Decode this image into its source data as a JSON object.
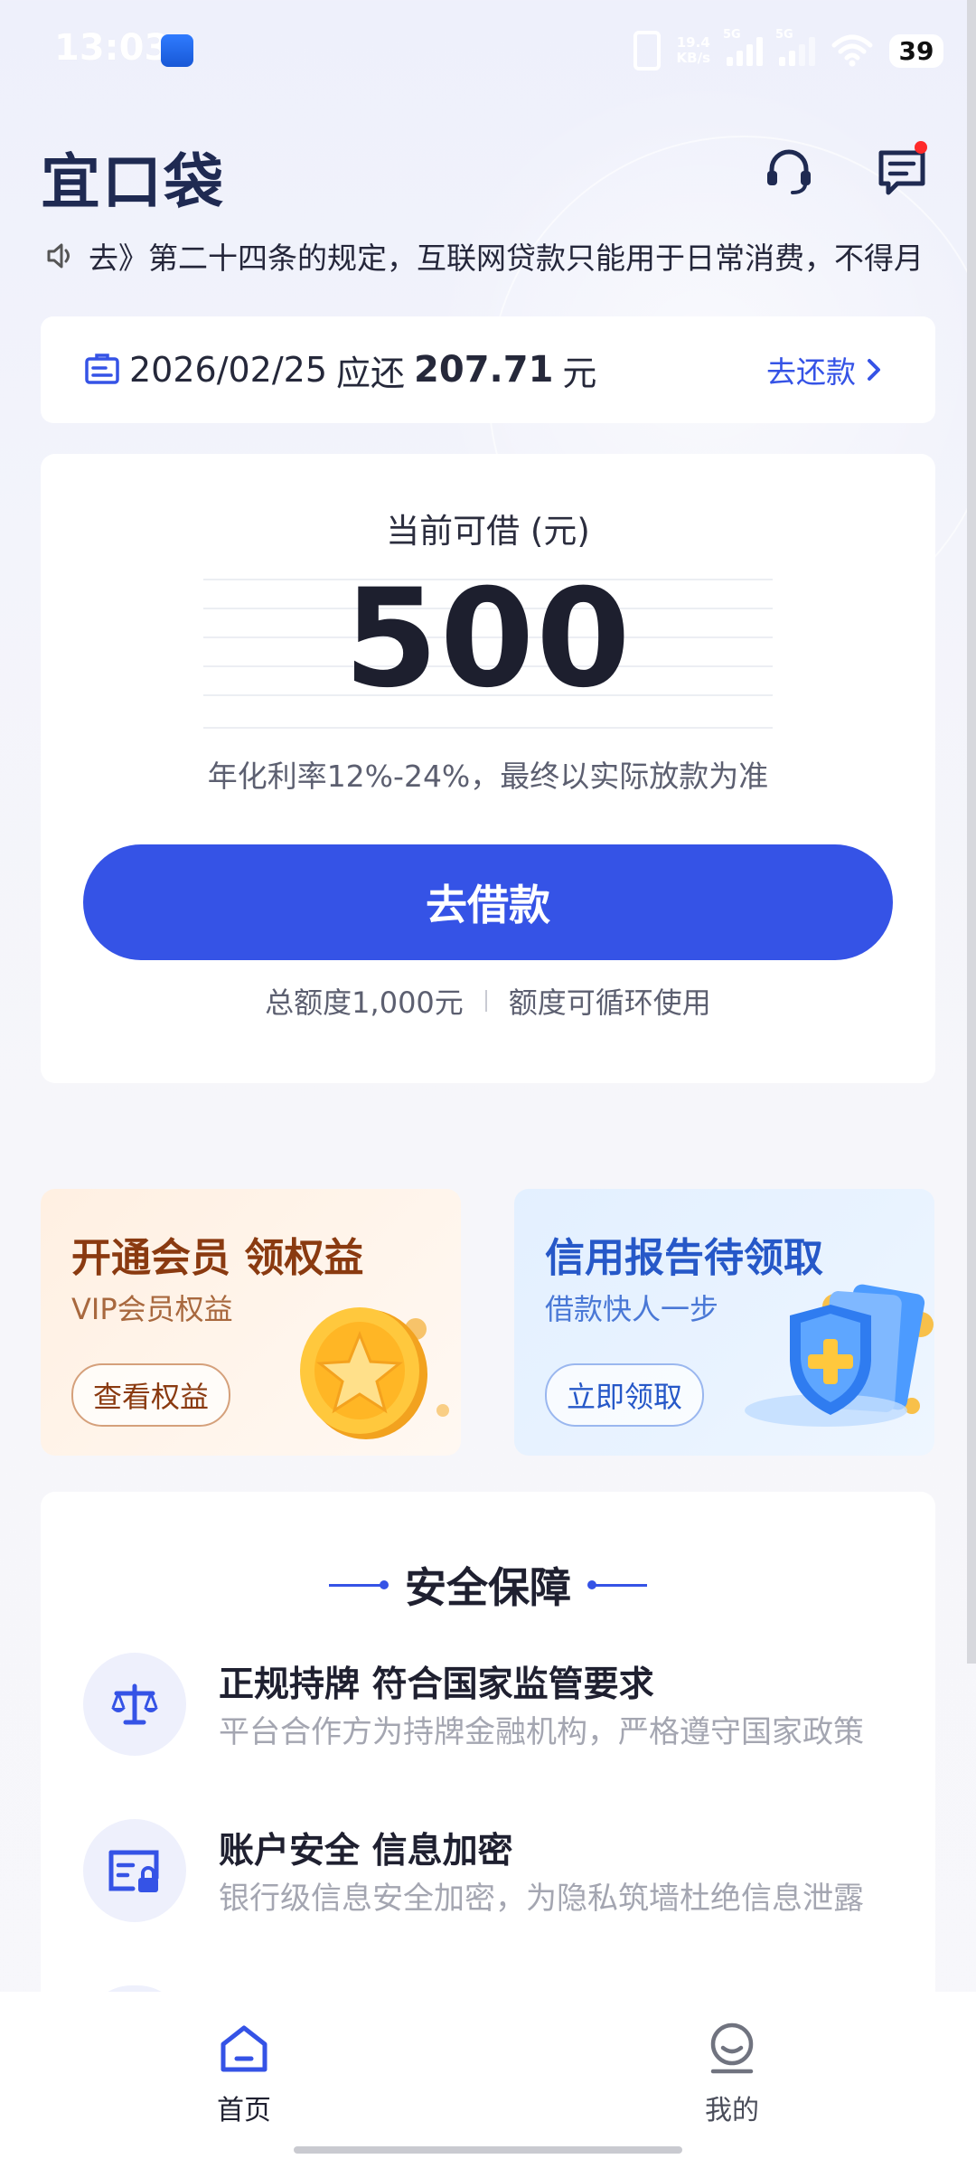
{
  "status_bar": {
    "time": "13:03",
    "net_speed_value": "19.4",
    "net_speed_unit": "KB/s",
    "sim1_tag": "5G",
    "sim2_tag": "5G",
    "battery": "39"
  },
  "header": {
    "logo_text": "宜口袋",
    "service_icon": "headset-icon",
    "message_icon": "message-icon"
  },
  "notice": {
    "icon": "speaker-icon",
    "text": "去》第二十四条的规定，互联网贷款只能用于日常消费，不得月"
  },
  "repay": {
    "date": "2026/02/25",
    "due_label": "应还",
    "amount": "207.71",
    "unit": "元",
    "action_label": "去还款"
  },
  "loan_card": {
    "caption": "当前可借 (元)",
    "available": "500",
    "rate_note": "年化利率12%-24%，最终以实际放款为准",
    "borrow_button": "去借款",
    "total_quota": "总额度1,000元",
    "quota_note": "额度可循环使用"
  },
  "promos": [
    {
      "title": "开通会员 领权益",
      "subtitle": "VIP会员权益",
      "button": "查看权益",
      "icon": "gold-star-coin-icon"
    },
    {
      "title": "信用报告待领取",
      "subtitle": "借款快人一步",
      "button": "立即领取",
      "icon": "shield-document-icon"
    }
  ],
  "security": {
    "title": "安全保障",
    "items": [
      {
        "icon": "scale-icon",
        "heading": "正规持牌 符合国家监管要求",
        "desc": "平台合作方为持牌金融机构，严格遵守国家政策"
      },
      {
        "icon": "id-lock-icon",
        "heading": "账户安全 信息加密",
        "desc": "银行级信息安全加密，为隐私筑墙杜绝信息泄露"
      }
    ]
  },
  "nav": [
    {
      "label": "首页",
      "icon": "home-icon",
      "active": true
    },
    {
      "label": "我的",
      "icon": "profile-icon",
      "active": false
    }
  ],
  "colors": {
    "primary": "#3553e6",
    "logo": "#1f2a52",
    "notification_dot": "#ff2a2a"
  }
}
